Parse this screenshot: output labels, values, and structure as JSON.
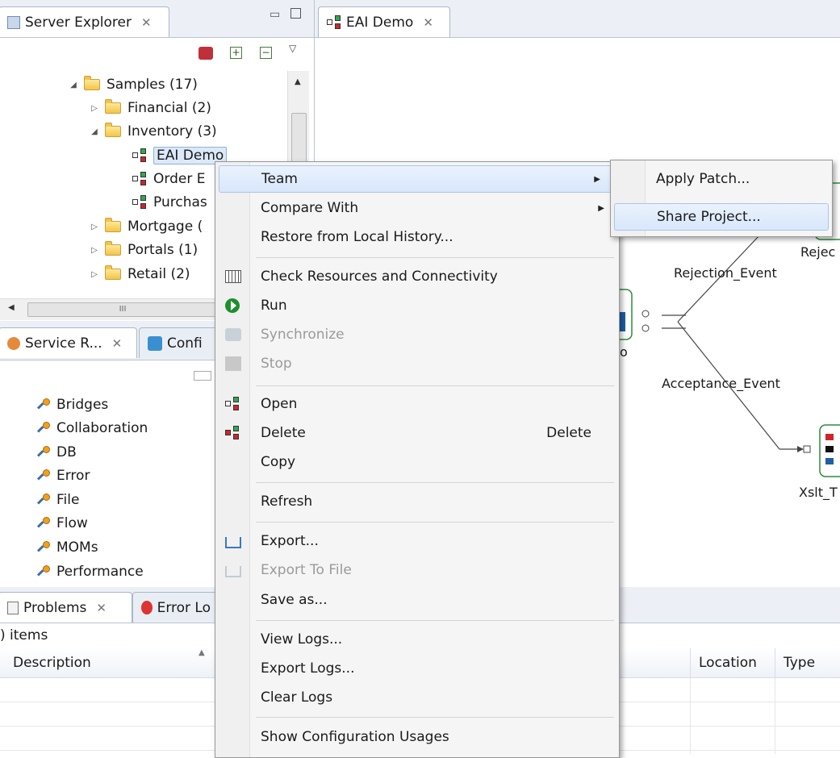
{
  "server_explorer": {
    "tab_label": "Server Explorer",
    "tree": [
      {
        "label": "Samples (17)",
        "type": "folder",
        "expanded": true
      },
      {
        "label": "Financial (2)",
        "type": "folder",
        "expanded": false
      },
      {
        "label": "Inventory (3)",
        "type": "folder",
        "expanded": true
      },
      {
        "label": "EAI Demo",
        "type": "flow",
        "selected": true
      },
      {
        "label": "Order E",
        "type": "flow"
      },
      {
        "label": "Purchas",
        "type": "flow"
      },
      {
        "label": "Mortgage (",
        "type": "folder",
        "expanded": false
      },
      {
        "label": "Portals (1)",
        "type": "folder",
        "expanded": false
      },
      {
        "label": "Retail (2)",
        "type": "folder",
        "expanded": false
      }
    ],
    "hscroll_thumb_glyph": "III"
  },
  "service_repo": {
    "tab_label": "Service R...",
    "tab2_label": "Confi",
    "items": [
      "Bridges",
      "Collaboration",
      "DB",
      "Error",
      "File",
      "Flow",
      "MOMs",
      "Performance"
    ]
  },
  "problems": {
    "tab_label": "Problems",
    "tab2_label": "Error Lo",
    "count": ") items",
    "columns": [
      "Description",
      "Location",
      "Type"
    ]
  },
  "editor": {
    "tab_label": "EAI Demo",
    "labels": {
      "rejection_event": "Rejection_Event",
      "acceptance_event": "Acceptance_Event",
      "reject_partial": "Rejec",
      "xslt_partial": "Xslt_T",
      "small_partial": "o"
    }
  },
  "context_menu": {
    "items": [
      {
        "label": "Team",
        "submenu": true,
        "highlighted": true
      },
      {
        "label": "Compare With",
        "submenu": true
      },
      {
        "label": "Restore from Local History..."
      },
      {
        "separator": true
      },
      {
        "label": "Check Resources and Connectivity",
        "icon": "calendar-icon"
      },
      {
        "label": "Run",
        "icon": "run-icon"
      },
      {
        "label": "Synchronize",
        "icon": "sync-icon",
        "disabled": true
      },
      {
        "label": "Stop",
        "icon": "stop-icon",
        "disabled": true
      },
      {
        "separator": true
      },
      {
        "label": "Open",
        "icon": "flow-icon"
      },
      {
        "label": "Delete",
        "icon": "delete-flow-icon",
        "accelerator": "Delete"
      },
      {
        "label": "Copy"
      },
      {
        "separator": true
      },
      {
        "label": "Refresh"
      },
      {
        "separator": true
      },
      {
        "label": "Export...",
        "icon": "export-icon"
      },
      {
        "label": "Export To File",
        "icon": "export-file-icon",
        "disabled": true
      },
      {
        "label": "Save as..."
      },
      {
        "separator": true
      },
      {
        "label": "View Logs..."
      },
      {
        "label": "Export Logs..."
      },
      {
        "label": "Clear Logs"
      },
      {
        "separator": true
      },
      {
        "label": "Show Configuration Usages"
      }
    ]
  },
  "team_submenu": {
    "items": [
      {
        "label": "Apply Patch..."
      },
      {
        "label": "Share Project...",
        "highlighted": true
      }
    ]
  },
  "colors": {
    "accent": "#2e8b3d",
    "highlight": "#d8e7fb",
    "run_green": "#1f8f2e"
  }
}
